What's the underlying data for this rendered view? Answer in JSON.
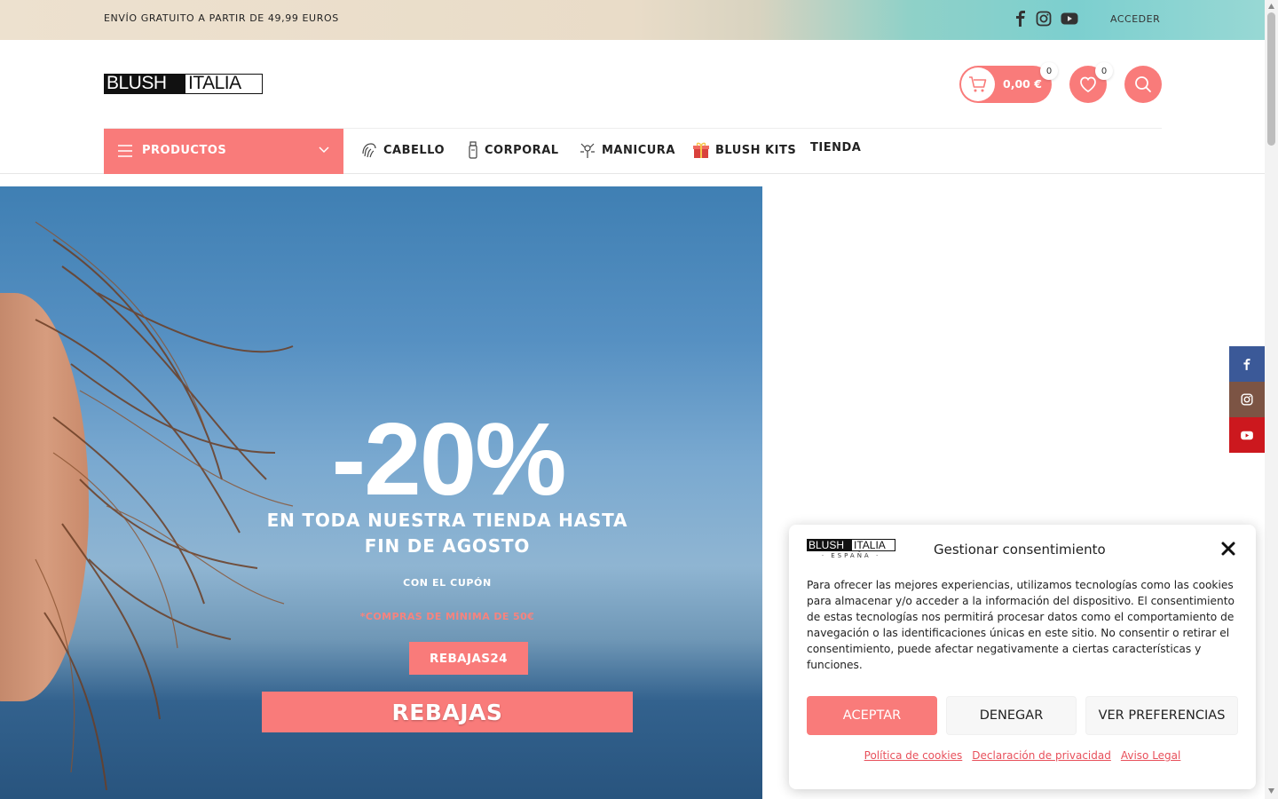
{
  "topbar": {
    "promo": "ENVÍO GRATUITO A PARTIR DE 49,99 EUROS",
    "login": "ACCEDER",
    "social_icons": [
      "facebook-icon",
      "instagram-icon",
      "youtube-icon"
    ]
  },
  "header": {
    "logo_left": "BLUSH",
    "logo_right": "ITALIA",
    "cart_total": "0,00 €",
    "cart_count": "0",
    "wishlist_count": "0"
  },
  "nav": {
    "products_label": "PRODUCTOS",
    "items": [
      {
        "label": "CABELLO",
        "icon": "hair-icon"
      },
      {
        "label": "CORPORAL",
        "icon": "bottle-icon"
      },
      {
        "label": "MANICURA",
        "icon": "manicure-icon"
      },
      {
        "label": "BLUSH KITS",
        "icon": "gift-icon"
      },
      {
        "label": "TIENDA",
        "icon": ""
      }
    ]
  },
  "hero": {
    "discount": "-20%",
    "subtitle": "EN TODA NUESTRA TIENDA HASTA FIN DE AGOSTO",
    "coupon_label": "CON EL CUPÓN",
    "minimum_note": "*COMPRAS DE MÍNIMA DE 50€",
    "coupon_code": "REBAJAS24",
    "cta": "REBAJAS"
  },
  "cookie": {
    "logo_left": "BLUSH",
    "logo_right": "ITALIA",
    "logo_sub": "· ESPAÑA ·",
    "title": "Gestionar consentimiento",
    "text": "Para ofrecer las mejores experiencias, utilizamos tecnologías como las cookies para almacenar y/o acceder a la información del dispositivo. El consentimiento de estas tecnologías nos permitirá procesar datos como el comportamiento de navegación o las identificaciones únicas en este sitio. No consentir o retirar el consentimiento, puede afectar negativamente a ciertas características y funciones.",
    "accept": "ACEPTAR",
    "deny": "DENEGAR",
    "preferences": "VER PREFERENCIAS",
    "links": [
      "Política de cookies",
      "Declaración de privacidad",
      "Aviso Legal"
    ]
  },
  "colors": {
    "accent": "#f97b7a",
    "facebook": "#3b5998",
    "instagram": "#7c5444",
    "youtube": "#cc181e"
  }
}
